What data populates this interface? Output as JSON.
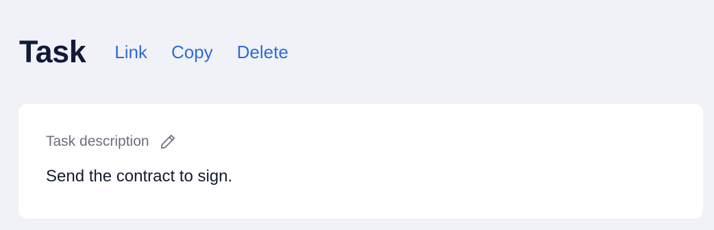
{
  "header": {
    "title": "Task",
    "actions": [
      {
        "label": "Link"
      },
      {
        "label": "Copy"
      },
      {
        "label": "Delete"
      }
    ]
  },
  "card": {
    "label": "Task description",
    "edit_icon": "pencil-icon",
    "description": "Send the contract to sign."
  },
  "colors": {
    "background": "#f1f2f7",
    "title": "#111a3a",
    "link": "#2f6bd8",
    "label": "#6b6f7b",
    "card": "#ffffff"
  }
}
